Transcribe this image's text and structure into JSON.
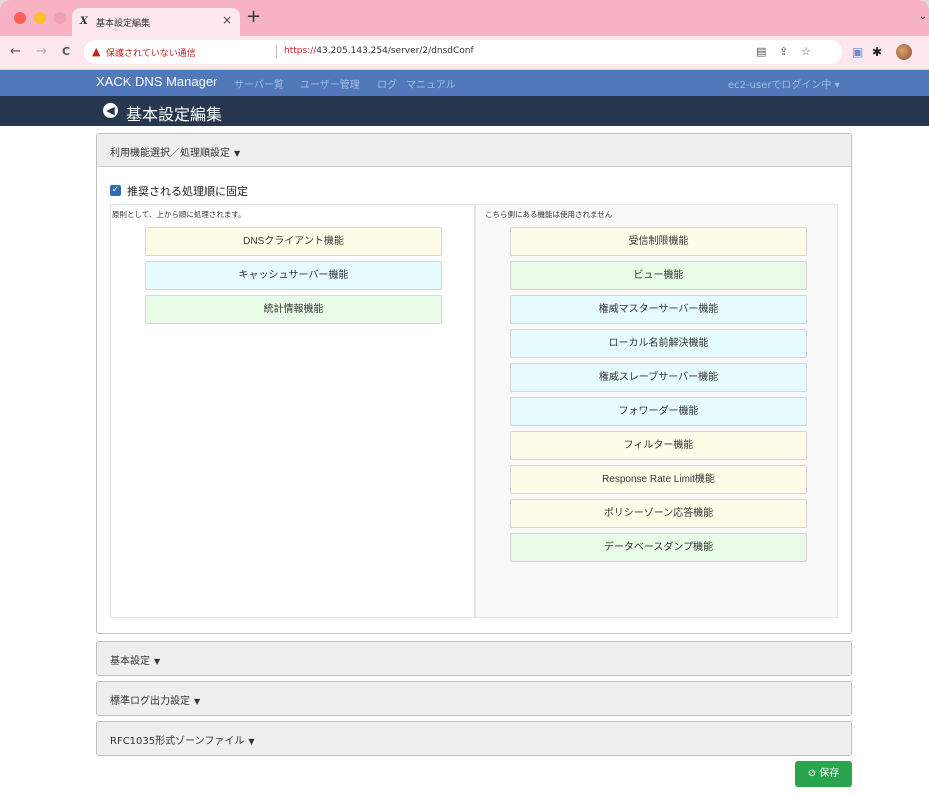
{
  "browser": {
    "tab_title": "基本設定編集",
    "tab_favicon": "X",
    "new_tab_label": "+",
    "security_warning": "保護されていない通信",
    "url_scheme": "https://",
    "url_rest": "43.205.143.254/server/2/dnsdConf",
    "nav": {
      "back": "←",
      "forward": "→",
      "reload": "C"
    }
  },
  "app": {
    "brand": "XACK DNS Manager",
    "nav_links": [
      "サーバー覧",
      "ユーザー管理",
      "ログ",
      "マニュアル"
    ],
    "user_menu": "ec2-userでログイン中 ▾"
  },
  "page": {
    "title": "基本設定編集"
  },
  "feature_card": {
    "header": "利用機能選択／処理順設定",
    "fix_order_label": "推奨される処理順に固定",
    "fix_order_checked": true,
    "left_caption": "原則として、上から順に処理されます。",
    "right_caption": "こちら側にある機能は使用されません",
    "active_features": [
      {
        "label": "DNSクライアント機能",
        "color": "#fefde8"
      },
      {
        "label": "キャッシュサーバー機能",
        "color": "#e6fbfd"
      },
      {
        "label": "統計情報機能",
        "color": "#e8fbe7"
      }
    ],
    "unused_features": [
      {
        "label": "受信制限機能",
        "color": "#fefde8"
      },
      {
        "label": "ビュー機能",
        "color": "#e8fbe7"
      },
      {
        "label": "権威マスターサーバー機能",
        "color": "#e6fbfd"
      },
      {
        "label": "ローカル名前解決機能",
        "color": "#e6fbfd"
      },
      {
        "label": "権威スレーブサーバー機能",
        "color": "#e6fbfd"
      },
      {
        "label": "フォワーダー機能",
        "color": "#e6fbfd"
      },
      {
        "label": "フィルター機能",
        "color": "#fefde8"
      },
      {
        "label": "Response Rate Limit機能",
        "color": "#fefde8"
      },
      {
        "label": "ポリシーゾーン応答機能",
        "color": "#fefde8"
      },
      {
        "label": "データベースダンプ機能",
        "color": "#e8fbe7"
      }
    ]
  },
  "collapsed_sections": [
    "基本設定",
    "標準ログ出力設定",
    "RFC1035形式ゾーンファイル"
  ],
  "save_button": "保存"
}
